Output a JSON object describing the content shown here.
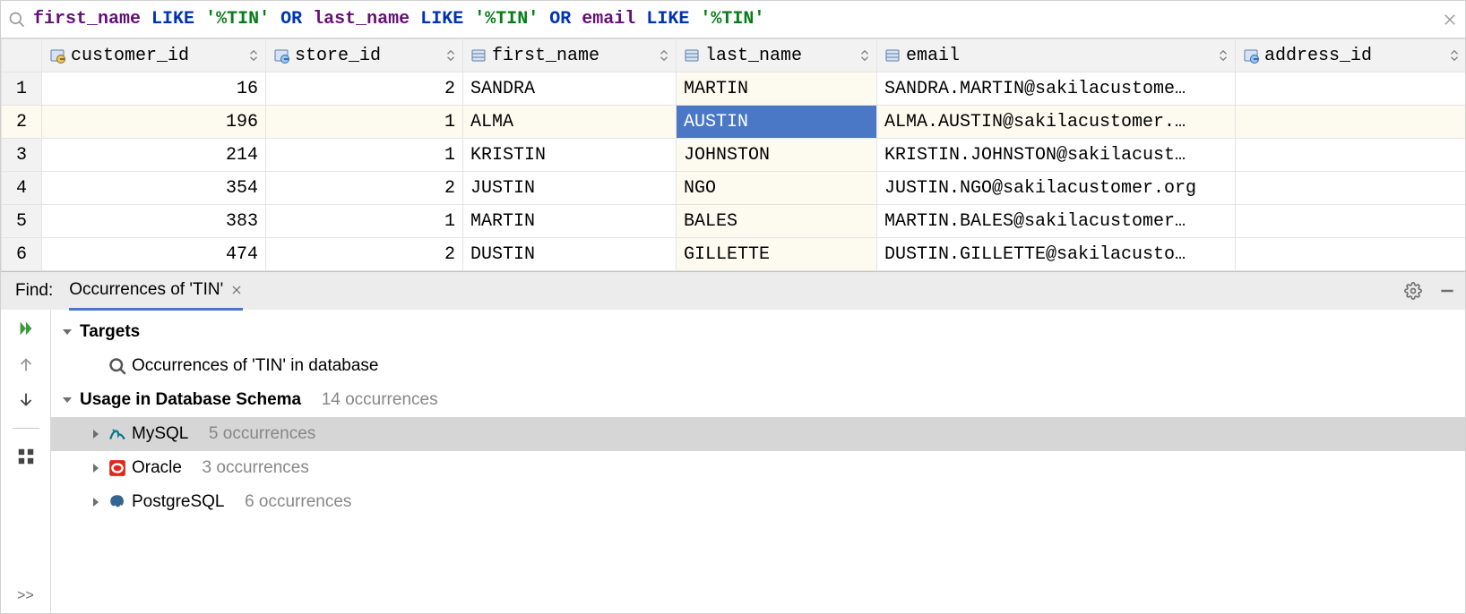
{
  "filter": {
    "tokens": [
      {
        "t": "first_name",
        "c": "col"
      },
      {
        "t": " "
      },
      {
        "t": "LIKE",
        "c": "key"
      },
      {
        "t": " "
      },
      {
        "t": "'%TIN'",
        "c": "str"
      },
      {
        "t": " "
      },
      {
        "t": "OR",
        "c": "key"
      },
      {
        "t": " "
      },
      {
        "t": "last_name",
        "c": "col"
      },
      {
        "t": " "
      },
      {
        "t": "LIKE",
        "c": "key"
      },
      {
        "t": " "
      },
      {
        "t": "'%TIN'",
        "c": "str"
      },
      {
        "t": " "
      },
      {
        "t": "OR",
        "c": "key"
      },
      {
        "t": " "
      },
      {
        "t": "email",
        "c": "col"
      },
      {
        "t": " "
      },
      {
        "t": "LIKE",
        "c": "key"
      },
      {
        "t": " "
      },
      {
        "t": "'%TIN'",
        "c": "str"
      }
    ]
  },
  "columns": [
    {
      "name": "customer_id",
      "kind": "pk"
    },
    {
      "name": "store_id",
      "kind": "fk"
    },
    {
      "name": "first_name",
      "kind": "col"
    },
    {
      "name": "last_name",
      "kind": "col",
      "highlight": true
    },
    {
      "name": "email",
      "kind": "col"
    },
    {
      "name": "address_id",
      "kind": "fk",
      "truncated": true
    }
  ],
  "rows": [
    {
      "n": 1,
      "customer_id": "16",
      "store_id": "2",
      "first_name": "SANDRA",
      "last_name": "MARTIN",
      "email": "SANDRA.MARTIN@sakilacustome…"
    },
    {
      "n": 2,
      "customer_id": "196",
      "store_id": "1",
      "first_name": "ALMA",
      "last_name": "AUSTIN",
      "email": "ALMA.AUSTIN@sakilacustomer.…",
      "selected": true,
      "sel_cell": "last_name"
    },
    {
      "n": 3,
      "customer_id": "214",
      "store_id": "1",
      "first_name": "KRISTIN",
      "last_name": "JOHNSTON",
      "email": "KRISTIN.JOHNSTON@sakilacust…"
    },
    {
      "n": 4,
      "customer_id": "354",
      "store_id": "2",
      "first_name": "JUSTIN",
      "last_name": "NGO",
      "email": "JUSTIN.NGO@sakilacustomer.org"
    },
    {
      "n": 5,
      "customer_id": "383",
      "store_id": "1",
      "first_name": "MARTIN",
      "last_name": "BALES",
      "email": "MARTIN.BALES@sakilacustomer…"
    },
    {
      "n": 6,
      "customer_id": "474",
      "store_id": "2",
      "first_name": "DUSTIN",
      "last_name": "GILLETTE",
      "email": "DUSTIN.GILLETTE@sakilacusto…"
    }
  ],
  "find": {
    "label": "Find:",
    "tab_label": "Occurrences of 'TIN'",
    "targets_label": "Targets",
    "targets_sub": "Occurrences of 'TIN' in database",
    "usage_label": "Usage in Database Schema",
    "usage_count": "14 occurrences",
    "items": [
      {
        "db": "MySQL",
        "count": "5 occurrences",
        "icon": "mysql",
        "selected": true
      },
      {
        "db": "Oracle",
        "count": "3 occurrences",
        "icon": "oracle"
      },
      {
        "db": "PostgreSQL",
        "count": "6 occurrences",
        "icon": "postgres"
      }
    ],
    "more_label": ">>"
  }
}
